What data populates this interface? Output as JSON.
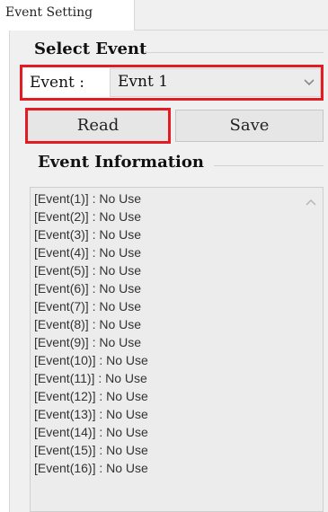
{
  "tab": {
    "label": "Event Setting"
  },
  "select_event": {
    "title": "Select Event",
    "event_label": "Event :",
    "event_value": "Evnt 1",
    "dropdown_icon": "chevron-down-icon"
  },
  "buttons": {
    "read": "Read",
    "save": "Save"
  },
  "event_information": {
    "title": "Event Information",
    "lines": [
      "[Event(1)] : No Use",
      "[Event(2)] : No Use",
      "[Event(3)] : No Use",
      "[Event(4)] : No Use",
      "[Event(5)] : No Use",
      "[Event(6)] : No Use",
      "[Event(7)] : No Use",
      "[Event(8)] : No Use",
      "[Event(9)] : No Use",
      "[Event(10)] : No Use",
      "[Event(11)] : No Use",
      "[Event(12)] : No Use",
      "[Event(13)] : No Use",
      "[Event(14)] : No Use",
      "[Event(15)] : No Use",
      "[Event(16)] : No Use"
    ],
    "scroll_icon": "chevron-up-icon"
  },
  "colors": {
    "highlight": "#e31b23",
    "panel_bg": "#f0f0f0"
  }
}
